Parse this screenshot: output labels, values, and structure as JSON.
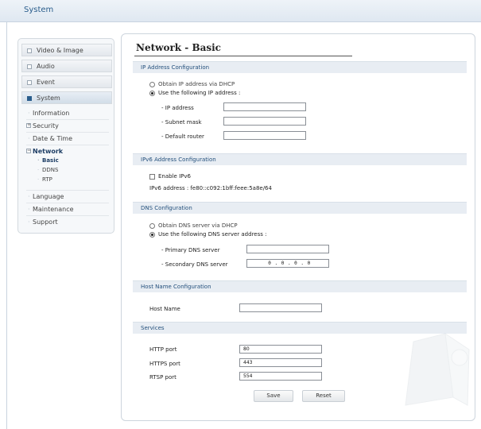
{
  "app": {
    "title": "System"
  },
  "sidebar": {
    "categories": [
      {
        "label": "Video & Image"
      },
      {
        "label": "Audio"
      },
      {
        "label": "Event"
      },
      {
        "label": "System"
      }
    ],
    "items": [
      {
        "label": "Information"
      },
      {
        "label": "Security"
      },
      {
        "label": "Date & Time"
      },
      {
        "label": "Network"
      },
      {
        "label": "Language"
      },
      {
        "label": "Maintenance"
      },
      {
        "label": "Support"
      }
    ],
    "network_items": [
      {
        "label": "Basic"
      },
      {
        "label": "DDNS"
      },
      {
        "label": "RTP"
      }
    ]
  },
  "main": {
    "title": "Network - Basic",
    "ip": {
      "heading": "IP Address Configuration",
      "dhcp_label": "Obtain IP address via DHCP",
      "static_label": "Use the following IP address :",
      "ip_label": "- IP address",
      "subnet_label": "- Subnet mask",
      "router_label": "- Default router",
      "ip_value": "",
      "subnet_value": "",
      "router_value": ""
    },
    "ipv6": {
      "heading": "IPv6 Address Configuration",
      "enable_label": "Enable IPv6",
      "address_text": "IPv6 address : fe80::c092:1bff:feee:5a8e/64"
    },
    "dns": {
      "heading": "DNS Configuration",
      "dhcp_label": "Obtain DNS server via DHCP",
      "static_label": "Use the following DNS server address :",
      "primary_label": "- Primary DNS server",
      "secondary_label": "- Secondary DNS server",
      "primary_value": "",
      "secondary_value": "0 . 0 . 0 . 0"
    },
    "host": {
      "heading": "Host Name Configuration",
      "label": "Host Name",
      "value": ""
    },
    "services": {
      "heading": "Services",
      "http_label": "HTTP port",
      "http_value": "80",
      "https_label": "HTTPS port",
      "https_value": "443",
      "rtsp_label": "RTSP port",
      "rtsp_value": "554"
    },
    "buttons": {
      "save": "Save",
      "reset": "Reset"
    }
  }
}
